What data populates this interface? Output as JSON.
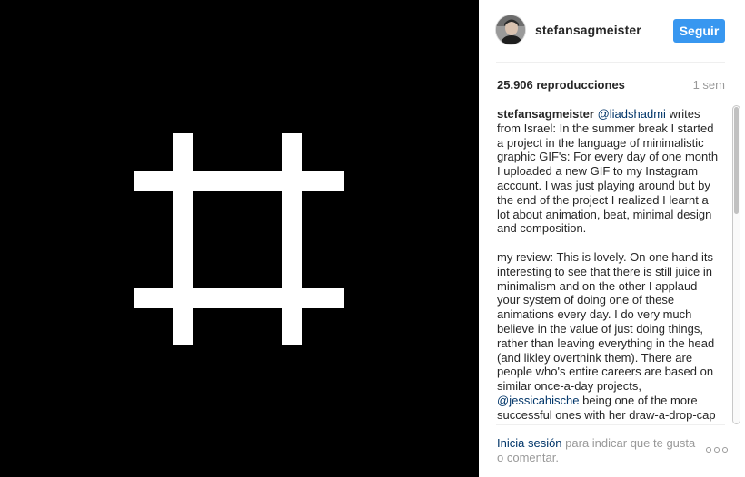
{
  "post": {
    "username": "stefansagmeister",
    "follow_label": "Seguir",
    "views": "25.906 reproducciones",
    "time_ago": "1 sem"
  },
  "caption": {
    "author": "stefansagmeister",
    "mention1": "@liadshadmi",
    "text1": " writes from Israel: In the summer break I started a project in the language of minimalistic graphic GIF's: For every day of one month I uploaded a new GIF to my Instagram account. I was just playing around but by the end of the project I realized I learnt a lot about animation, beat, minimal design and composition.",
    "text2": "my review: This is lovely. On one hand its interesting to see that there is still juice in minimalism and on the other I applaud your system of doing one of these animations every day. I do very much believe in the value of just doing things, rather than leaving everything in the head (and likley overthink them). There are people who's entire careers are based on similar once-a-day projects, ",
    "mention2": "@jessicahische",
    "text3": " being one of the more successful ones with her draw-a-drop-cap project."
  },
  "footer": {
    "login": "Inicia sesión",
    "prompt": " para indicar que te gusta o comentar."
  },
  "colors": {
    "media_bg": "#000000",
    "shape": "#ffffff",
    "accent": "#3897f0",
    "link": "#003569",
    "muted": "#999999"
  },
  "icons": {
    "more": "ellipsis-icon",
    "avatar": "profile-photo"
  }
}
